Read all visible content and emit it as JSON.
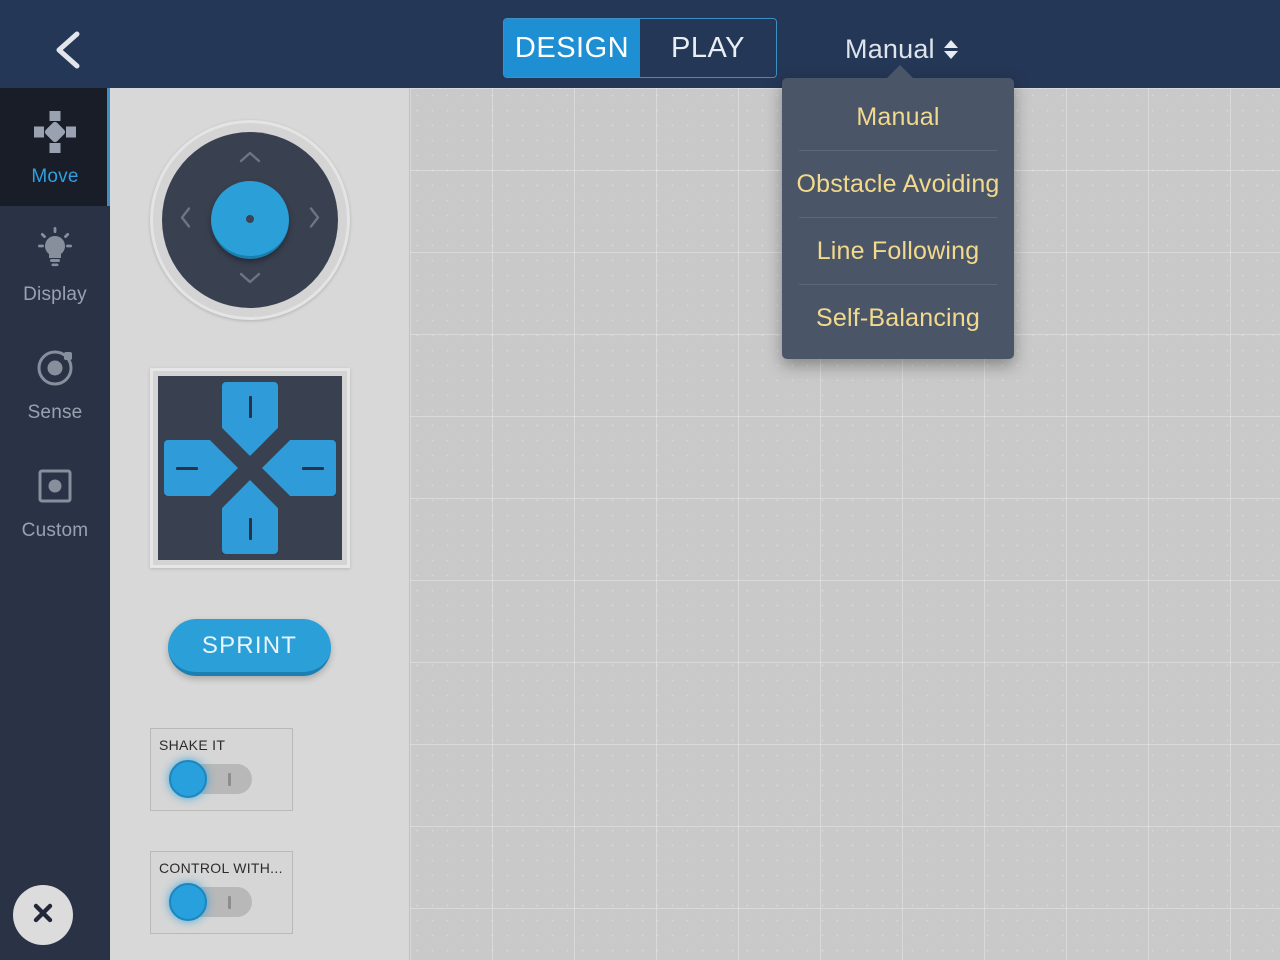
{
  "topbar": {
    "back_icon": "chevron-left-icon",
    "tabs": [
      {
        "label": "DESIGN",
        "active": true
      },
      {
        "label": "PLAY",
        "active": false
      }
    ],
    "mode_selector": {
      "value": "Manual",
      "stepper_icon": "up-down-chevron-icon"
    }
  },
  "dropdown": {
    "open": true,
    "items": [
      {
        "label": "Manual"
      },
      {
        "label": "Obstacle Avoiding"
      },
      {
        "label": "Line Following"
      },
      {
        "label": "Self-Balancing"
      }
    ]
  },
  "sidebar": {
    "items": [
      {
        "label": "Move",
        "icon": "dpad-icon",
        "active": true
      },
      {
        "label": "Display",
        "icon": "lightbulb-icon",
        "active": false
      },
      {
        "label": "Sense",
        "icon": "sensor-icon",
        "active": false
      },
      {
        "label": "Custom",
        "icon": "square-dot-icon",
        "active": false
      }
    ],
    "close_button": {
      "icon": "close-x-icon"
    }
  },
  "panel": {
    "joystick": {
      "name": "joystick-control"
    },
    "dpad": {
      "name": "dpad-control"
    },
    "sprint": {
      "label": "SPRINT"
    },
    "toggles": [
      {
        "title": "SHAKE IT",
        "state": "off"
      },
      {
        "title": "CONTROL WITH...",
        "state": "off"
      }
    ]
  },
  "colors": {
    "accent_blue": "#1f8fd4",
    "topbar_navy": "#253756",
    "sidebar_navy": "#2a3245",
    "sidebar_active": "#191d28",
    "dropdown_bg": "#4a5668",
    "dropdown_text": "#f3d98b",
    "panel_gray": "#d8d8d8",
    "canvas_gray": "#c9c9c9",
    "control_dark": "#394050"
  }
}
